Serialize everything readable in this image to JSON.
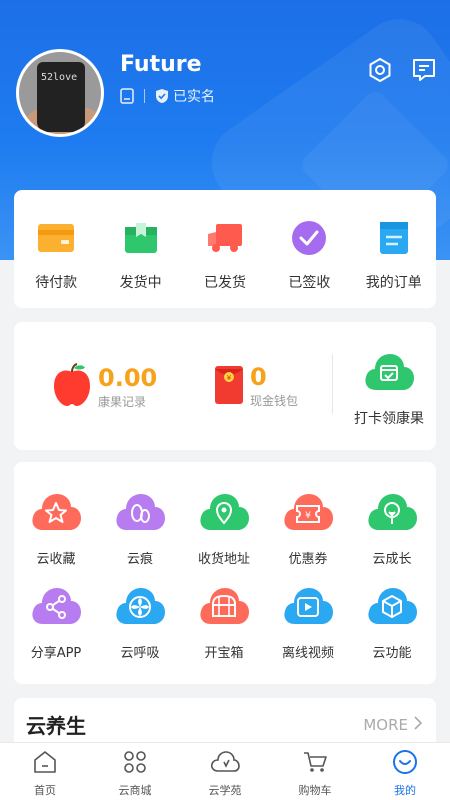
{
  "profile": {
    "username": "Future",
    "verified_label": "已实名",
    "avatar_cup_text": "52love"
  },
  "orders": [
    {
      "label": "待付款",
      "icon": "wallet-icon"
    },
    {
      "label": "发货中",
      "icon": "package-icon"
    },
    {
      "label": "已发货",
      "icon": "truck-icon"
    },
    {
      "label": "已签收",
      "icon": "check-circle-icon"
    },
    {
      "label": "我的订单",
      "icon": "order-list-icon"
    }
  ],
  "wallet": {
    "kangguo_value": "0.00",
    "kangguo_label": "康果记录",
    "cash_value": "0",
    "cash_label": "现金钱包",
    "checkin_label": "打卡领康果"
  },
  "services": [
    {
      "label": "云收藏",
      "icon": "star-icon",
      "color": "#ff6b5a"
    },
    {
      "label": "云痕",
      "icon": "footprint-icon",
      "color": "#b77cf0"
    },
    {
      "label": "收货地址",
      "icon": "location-pin-icon",
      "color": "#2fc76d"
    },
    {
      "label": "优惠券",
      "icon": "coupon-icon",
      "color": "#ff6b5a"
    },
    {
      "label": "云成长",
      "icon": "tree-icon",
      "color": "#2fc76d"
    },
    {
      "label": "分享APP",
      "icon": "share-icon",
      "color": "#b77cf0"
    },
    {
      "label": "云呼吸",
      "icon": "fan-icon",
      "color": "#2aa8f2"
    },
    {
      "label": "开宝箱",
      "icon": "treasure-chest-icon",
      "color": "#ff6b5a"
    },
    {
      "label": "离线视频",
      "icon": "video-icon",
      "color": "#2aa8f2"
    },
    {
      "label": "云功能",
      "icon": "cube-icon",
      "color": "#2aa8f2"
    }
  ],
  "health": {
    "title": "云养生",
    "more_label": "MORE"
  },
  "tabs": [
    {
      "label": "首页",
      "icon": "home-icon"
    },
    {
      "label": "云商城",
      "icon": "grid-icon"
    },
    {
      "label": "云学苑",
      "icon": "cloud-icon"
    },
    {
      "label": "购物车",
      "icon": "cart-icon"
    },
    {
      "label": "我的",
      "icon": "profile-icon",
      "active": true
    }
  ],
  "colors": {
    "primary": "#1a73e8",
    "accent_orange": "#f7a21b"
  }
}
